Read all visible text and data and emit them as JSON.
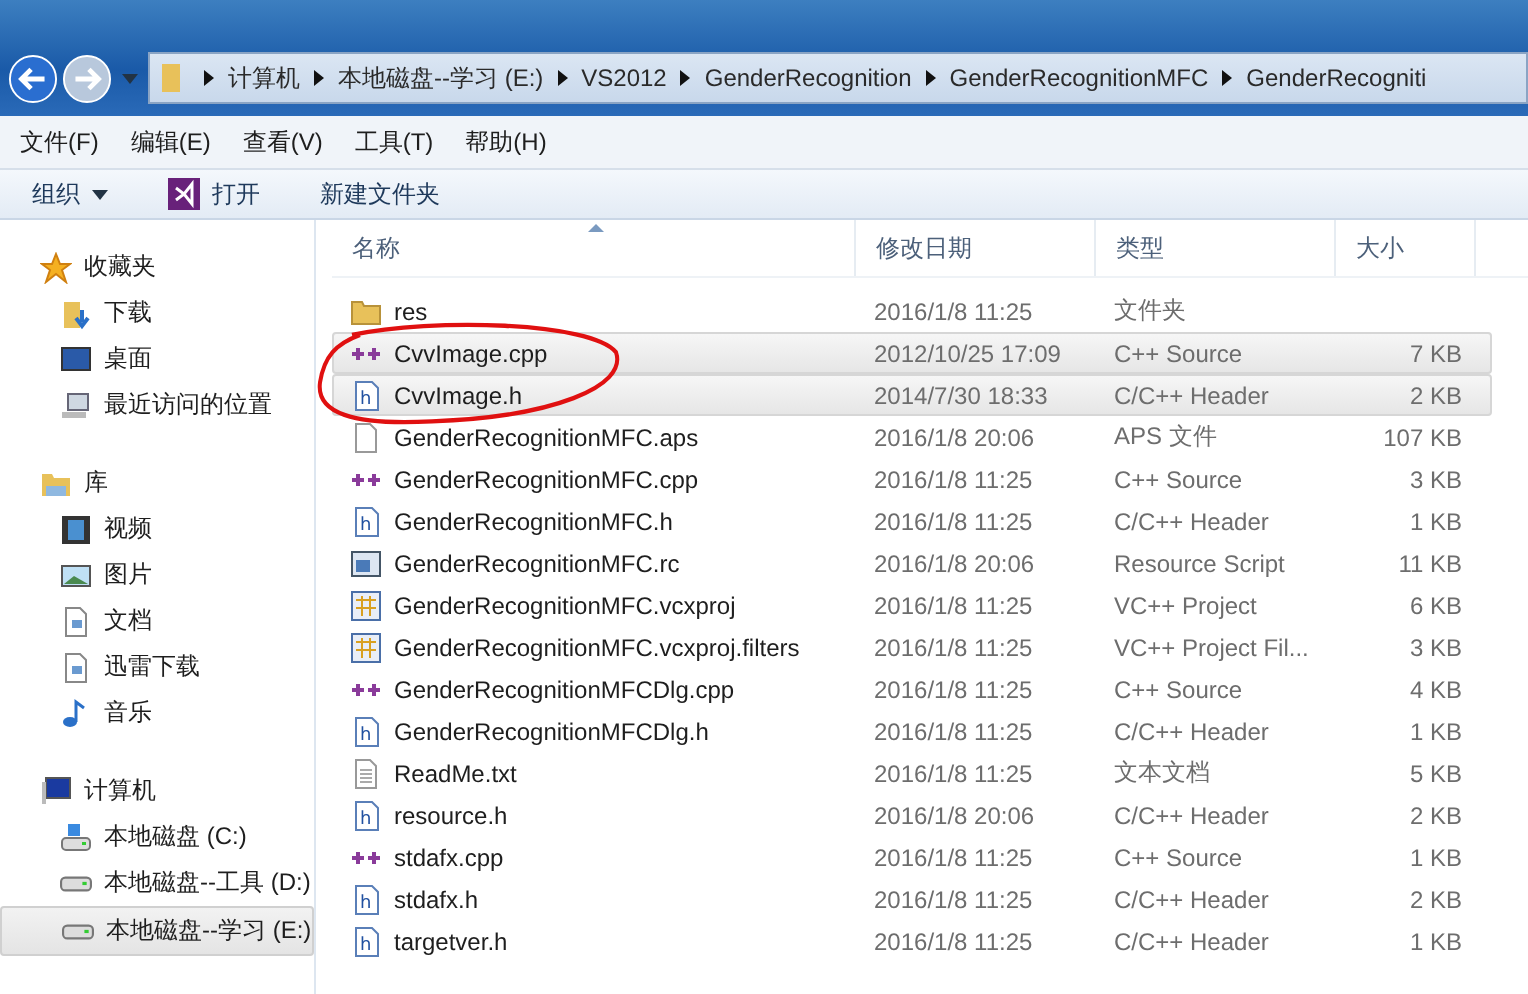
{
  "breadcrumb": [
    "计算机",
    "本地磁盘--学习 (E:)",
    "VS2012",
    "GenderRecognition",
    "GenderRecognitionMFC",
    "GenderRecogniti"
  ],
  "menu": [
    "文件(F)",
    "编辑(E)",
    "查看(V)",
    "工具(T)",
    "帮助(H)"
  ],
  "toolbar": [
    {
      "label": "组织",
      "kind": "dropdown"
    },
    {
      "label": "打开",
      "kind": "vs"
    },
    {
      "label": "新建文件夹",
      "kind": "plain"
    }
  ],
  "sidebar": [
    {
      "label": "收藏夹",
      "kind": "star",
      "children": [
        {
          "label": "下载",
          "kind": "download",
          "selected": false
        },
        {
          "label": "桌面",
          "kind": "desktop",
          "selected": false
        },
        {
          "label": "最近访问的位置",
          "kind": "recent",
          "selected": false
        }
      ]
    },
    {
      "label": "库",
      "kind": "library",
      "children": [
        {
          "label": "视频",
          "kind": "video",
          "selected": false
        },
        {
          "label": "图片",
          "kind": "picture",
          "selected": false
        },
        {
          "label": "文档",
          "kind": "doc",
          "selected": false
        },
        {
          "label": "迅雷下载",
          "kind": "doc2",
          "selected": false
        },
        {
          "label": "音乐",
          "kind": "music",
          "selected": false
        }
      ]
    },
    {
      "label": "计算机",
      "kind": "computer",
      "children": [
        {
          "label": "本地磁盘 (C:)",
          "kind": "sysdrive",
          "selected": false
        },
        {
          "label": "本地磁盘--工具 (D:)",
          "kind": "drive",
          "selected": false
        },
        {
          "label": "本地磁盘--学习 (E:)",
          "kind": "drive",
          "selected": true
        }
      ]
    }
  ],
  "columns": [
    "名称",
    "修改日期",
    "类型",
    "大小"
  ],
  "files": [
    {
      "name": "res",
      "date": "2016/1/8 11:25",
      "type": "文件夹",
      "kind": "folder",
      "selected": false
    },
    {
      "name": "CvvImage.cpp",
      "date": "2012/10/25 17:09",
      "type": "C++ Source",
      "size": "7 KB",
      "kind": "cpp",
      "selected": true
    },
    {
      "name": "CvvImage.h",
      "date": "2014/7/30 18:33",
      "type": "C/C++ Header",
      "size": "2 KB",
      "kind": "h",
      "selected": true
    },
    {
      "name": "GenderRecognitionMFC.aps",
      "date": "2016/1/8 20:06",
      "type": "APS 文件",
      "size": "107 KB",
      "kind": "blank",
      "selected": false
    },
    {
      "name": "GenderRecognitionMFC.cpp",
      "date": "2016/1/8 11:25",
      "type": "C++ Source",
      "size": "3 KB",
      "kind": "cpp",
      "selected": false
    },
    {
      "name": "GenderRecognitionMFC.h",
      "date": "2016/1/8 11:25",
      "type": "C/C++ Header",
      "size": "1 KB",
      "kind": "h",
      "selected": false
    },
    {
      "name": "GenderRecognitionMFC.rc",
      "date": "2016/1/8 20:06",
      "type": "Resource Script",
      "size": "11 KB",
      "kind": "rc",
      "selected": false
    },
    {
      "name": "GenderRecognitionMFC.vcxproj",
      "date": "2016/1/8 11:25",
      "type": "VC++ Project",
      "size": "6 KB",
      "kind": "proj",
      "selected": false
    },
    {
      "name": "GenderRecognitionMFC.vcxproj.filters",
      "date": "2016/1/8 11:25",
      "type": "VC++ Project Fil...",
      "size": "3 KB",
      "kind": "proj",
      "selected": false
    },
    {
      "name": "GenderRecognitionMFCDlg.cpp",
      "date": "2016/1/8 11:25",
      "type": "C++ Source",
      "size": "4 KB",
      "kind": "cpp",
      "selected": false
    },
    {
      "name": "GenderRecognitionMFCDlg.h",
      "date": "2016/1/8 11:25",
      "type": "C/C++ Header",
      "size": "1 KB",
      "kind": "h",
      "selected": false
    },
    {
      "name": "ReadMe.txt",
      "date": "2016/1/8 11:25",
      "type": "文本文档",
      "size": "5 KB",
      "kind": "txt",
      "selected": false
    },
    {
      "name": "resource.h",
      "date": "2016/1/8 20:06",
      "type": "C/C++ Header",
      "size": "2 KB",
      "kind": "h",
      "selected": false
    },
    {
      "name": "stdafx.cpp",
      "date": "2016/1/8 11:25",
      "type": "C++ Source",
      "size": "1 KB",
      "kind": "cpp",
      "selected": false
    },
    {
      "name": "stdafx.h",
      "date": "2016/1/8 11:25",
      "type": "C/C++ Header",
      "size": "2 KB",
      "kind": "h",
      "selected": false
    },
    {
      "name": "targetver.h",
      "date": "2016/1/8 11:25",
      "type": "C/C++ Header",
      "size": "1 KB",
      "kind": "h",
      "selected": false
    }
  ]
}
